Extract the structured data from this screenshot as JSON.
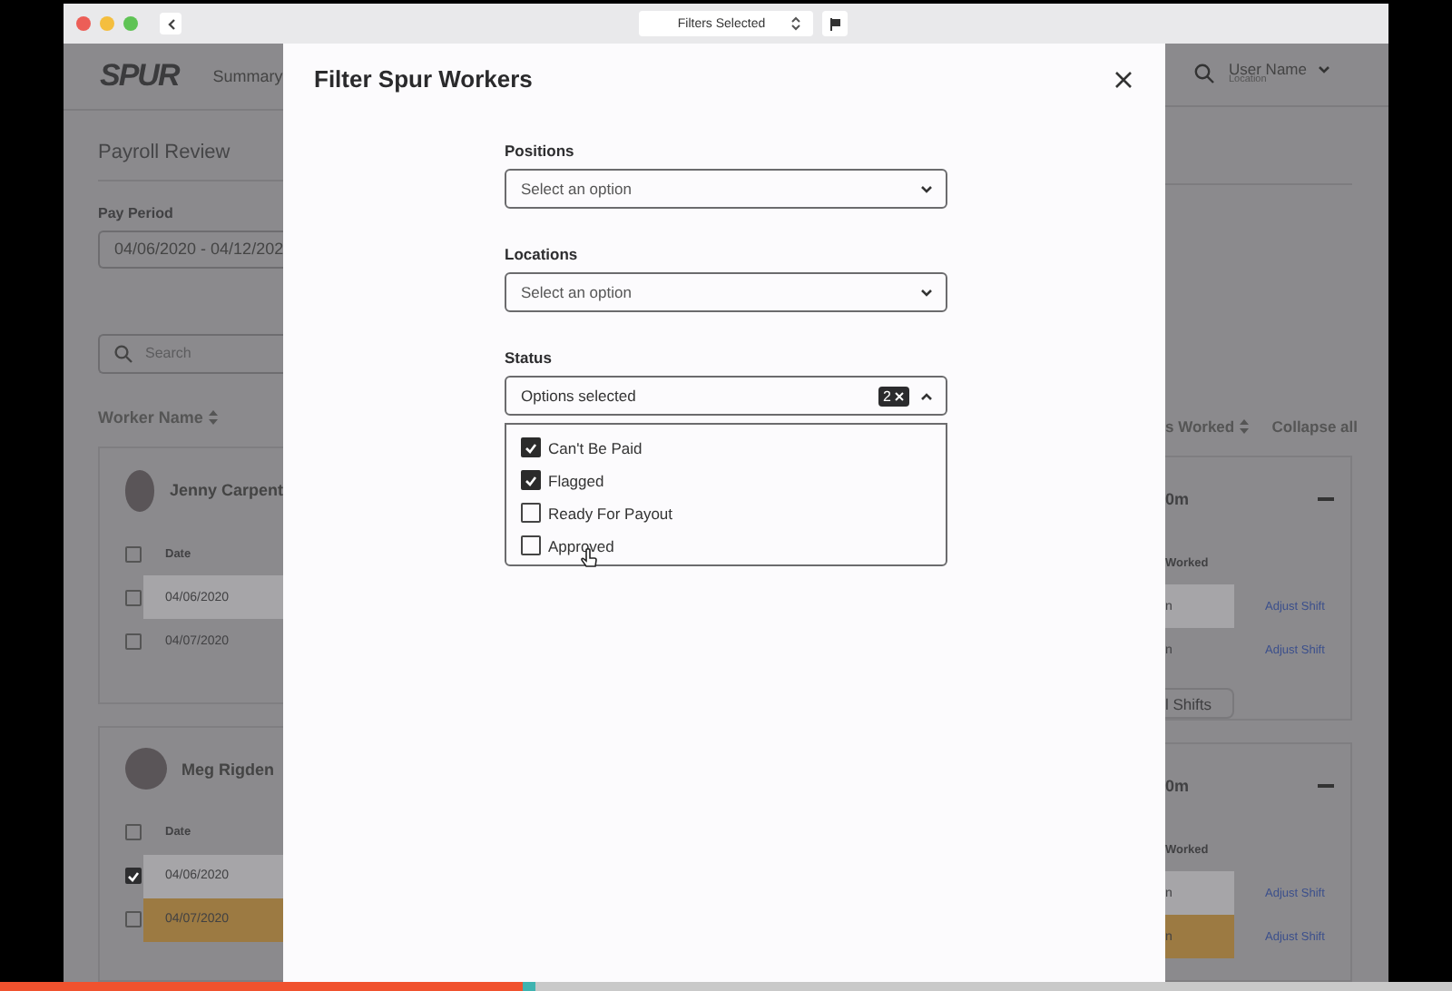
{
  "window": {
    "toolbar_select": "Filters Selected"
  },
  "page_left": {
    "logo": "SPUR",
    "nav_item": "Summary",
    "title": "Payroll Review",
    "pay_period": {
      "label": "Pay Period",
      "value": "04/06/2020 - 04/12/202"
    },
    "search": {
      "placeholder": "Search"
    },
    "sort_column": "Worker Name",
    "cards": [
      {
        "name": "Jenny Carpent",
        "header_checked": false,
        "column": "Date",
        "rows": [
          {
            "date": "04/06/2020",
            "checked": false,
            "highlighted": true,
            "flagged": false
          },
          {
            "date": "04/07/2020",
            "checked": false,
            "highlighted": false,
            "flagged": false
          }
        ]
      },
      {
        "name": "Meg Rigden",
        "header_checked": false,
        "column": "Date",
        "rows": [
          {
            "date": "04/06/2020",
            "checked": true,
            "highlighted": true,
            "flagged": false
          },
          {
            "date": "04/07/2020",
            "checked": false,
            "highlighted": false,
            "flagged": true
          }
        ]
      }
    ]
  },
  "page_right": {
    "user_name": "User Name",
    "location": "Location",
    "sort_column": "s Worked",
    "collapse": "Collapse all",
    "cards": [
      {
        "total": "0m",
        "column": "Worked",
        "rows": [
          {
            "cell": "n",
            "action": "Adjust Shift",
            "highlighted": true,
            "flagged": false
          },
          {
            "cell": "n",
            "action": "Adjust Shift",
            "highlighted": false,
            "flagged": false
          }
        ],
        "button": "l Shifts"
      },
      {
        "total": "0m",
        "column": "Worked",
        "rows": [
          {
            "cell": "n",
            "action": "Adjust Shift",
            "highlighted": true,
            "flagged": false
          },
          {
            "cell": "n",
            "action": "Adjust Shift",
            "highlighted": false,
            "flagged": true
          }
        ]
      }
    ]
  },
  "modal": {
    "title": "Filter Spur Workers",
    "fields": [
      {
        "label": "Positions",
        "placeholder": "Select an option",
        "expanded": false
      },
      {
        "label": "Locations",
        "placeholder": "Select an option",
        "expanded": false
      },
      {
        "label": "Status",
        "value": "Options selected",
        "count": "2",
        "expanded": true,
        "options": [
          {
            "label": "Can't Be Paid",
            "checked": true
          },
          {
            "label": "Flagged",
            "checked": true
          },
          {
            "label": "Ready For Payout",
            "checked": false
          },
          {
            "label": "Approved",
            "checked": false
          }
        ]
      }
    ]
  },
  "playback": {
    "level": 0.36
  }
}
